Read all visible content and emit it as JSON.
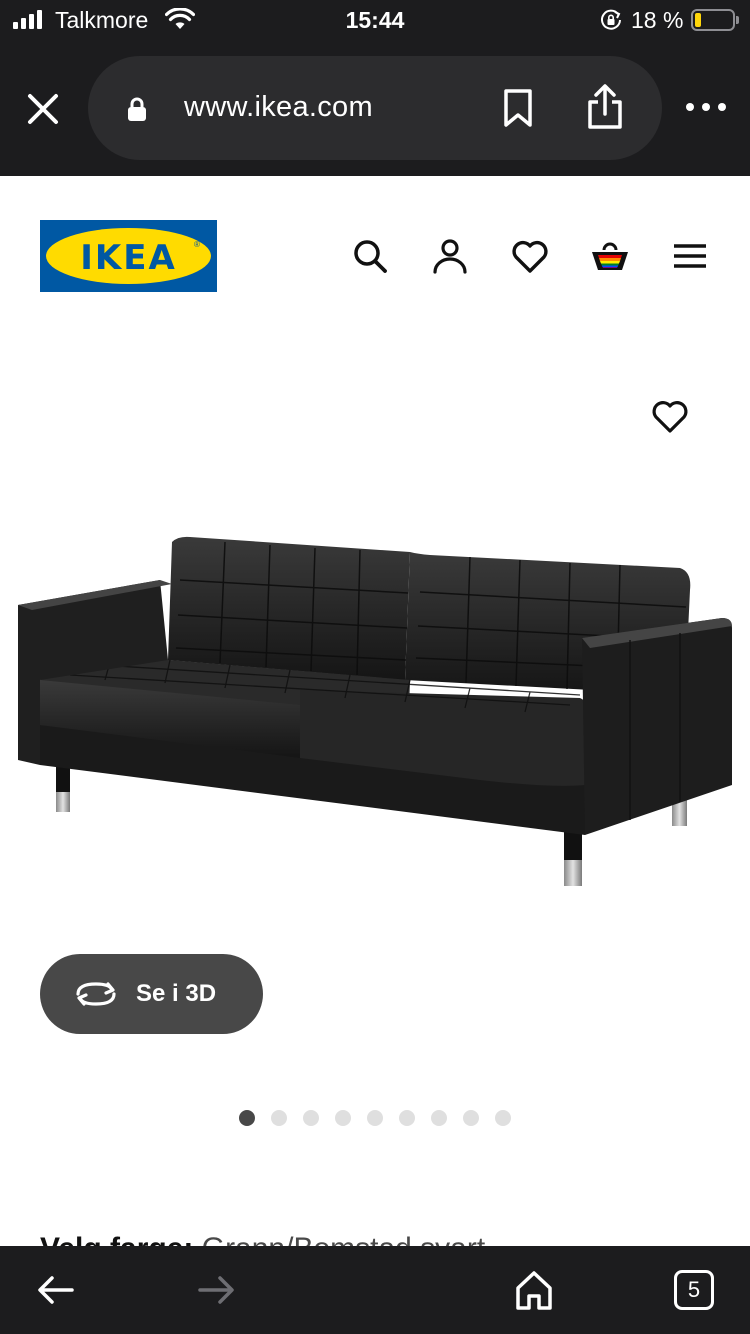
{
  "status_bar": {
    "carrier": "Talkmore",
    "time": "15:44",
    "battery_percent": "18 %",
    "battery_level": 0.18,
    "battery_color": "#ffd60a"
  },
  "browser": {
    "url": "www.ikea.com",
    "icons": [
      "close-icon",
      "lock-icon",
      "bookmark-icon",
      "share-icon",
      "more-icon"
    ]
  },
  "header": {
    "logo_text": "IKEA",
    "logo_reg": "®",
    "brand_colors": {
      "blue": "#0058a3",
      "yellow": "#ffdb00"
    },
    "icons": [
      "search-icon",
      "account-icon",
      "favourites-icon",
      "cart-icon",
      "menu-icon"
    ]
  },
  "product": {
    "favourite_icon": "heart-outline-icon",
    "image_alt": "black leather three-seat sofa",
    "view_3d_label": "Se i 3D",
    "gallery_count": 9,
    "gallery_active_index": 0,
    "color_label": "Velg farge:",
    "color_value": "Grann/Bomstad svart"
  },
  "toolbar": {
    "tab_count": "5",
    "icons": [
      "back-arrow-icon",
      "forward-arrow-icon",
      "home-icon",
      "tabs-icon"
    ]
  }
}
